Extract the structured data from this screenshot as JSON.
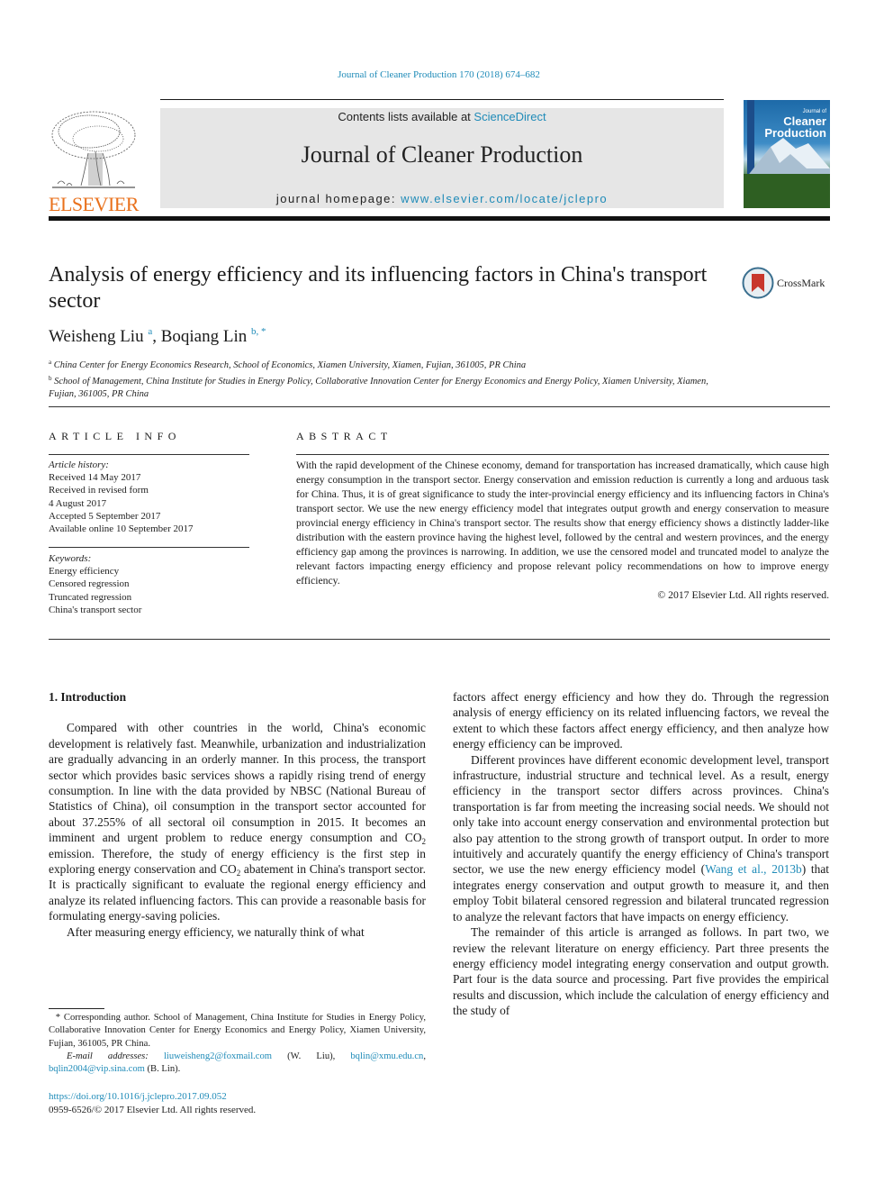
{
  "header": {
    "citation": "Journal of Cleaner Production 170 (2018) 674–682",
    "contents_prefix": "Contents lists available at ",
    "contents_link": "ScienceDirect",
    "journal_title": "Journal of Cleaner Production",
    "homepage_prefix": "journal homepage: ",
    "homepage_link": "www.elsevier.com/locate/jclepro",
    "publisher_wordmark": "ELSEVIER",
    "cover_small": "Journal of",
    "cover_line1": "Cleaner",
    "cover_line2": "Production",
    "brand_colors": {
      "elsevier_orange": "#e9711c",
      "link_blue": "#1f8bb8"
    }
  },
  "article": {
    "title": "Analysis of energy efficiency and its influencing factors in China's transport sector",
    "crossmark_label": "CrossMark",
    "authors": [
      {
        "name": "Weisheng Liu",
        "marks": "a"
      },
      {
        "name": "Boqiang Lin",
        "marks": "b, *"
      }
    ],
    "affiliations": [
      {
        "mark": "a",
        "text": "China Center for Energy Economics Research, School of Economics, Xiamen University, Xiamen, Fujian, 361005, PR China"
      },
      {
        "mark": "b",
        "text": "School of Management, China Institute for Studies in Energy Policy, Collaborative Innovation Center for Energy Economics and Energy Policy, Xiamen University, Xiamen, Fujian, 361005, PR China"
      }
    ]
  },
  "article_info": {
    "heading": "ARTICLE INFO",
    "history_label": "Article history:",
    "history": [
      "Received 14 May 2017",
      "Received in revised form",
      "4 August 2017",
      "Accepted 5 September 2017",
      "Available online 10 September 2017"
    ],
    "keywords_label": "Keywords:",
    "keywords": [
      "Energy efficiency",
      "Censored regression",
      "Truncated regression",
      "China's transport sector"
    ]
  },
  "abstract": {
    "heading": "ABSTRACT",
    "text": "With the rapid development of the Chinese economy, demand for transportation has increased dramatically, which cause high energy consumption in the transport sector. Energy conservation and emission reduction is currently a long and arduous task for China. Thus, it is of great significance to study the inter-provincial energy efficiency and its influencing factors in China's transport sector. We use the new energy efficiency model that integrates output growth and energy conservation to measure provincial energy efficiency in China's transport sector. The results show that energy efficiency shows a distinctly ladder-like distribution with the eastern province having the highest level, followed by the central and western provinces, and the energy efficiency gap among the provinces is narrowing. In addition, we use the censored model and truncated model to analyze the relevant factors impacting energy efficiency and propose relevant policy recommendations on how to improve energy efficiency.",
    "copyright": "© 2017 Elsevier Ltd. All rights reserved."
  },
  "body": {
    "section_heading": "1.  Introduction",
    "left_paragraphs": {
      "p1_a": "Compared with other countries in the world, China's economic development is relatively fast. Meanwhile, urbanization and industrialization are gradually advancing in an orderly manner. In this process, the transport sector which provides basic services shows a rapidly rising trend of energy consumption. In line with the data provided by NBSC (National Bureau of Statistics of China), oil consumption in the transport sector accounted for about 37.255% of all sectoral oil consumption in 2015. It becomes an imminent and urgent problem to reduce energy consumption and CO",
      "p1_b": " emission. Therefore, the study of energy efficiency is the first step in exploring energy conservation and CO",
      "p1_c": " abatement in China's transport sector. It is practically significant to evaluate the regional energy efficiency and analyze its related influencing factors. This can provide a reasonable basis for formulating energy-saving policies.",
      "co2_sub": "2",
      "p2": "After measuring energy efficiency, we naturally think of what"
    },
    "right_paragraphs": {
      "p1": "factors affect energy efficiency and how they do. Through the regression analysis of energy efficiency on its related influencing factors, we reveal the extent to which these factors affect energy efficiency, and then analyze how energy efficiency can be improved.",
      "p2_a": "Different provinces have different economic development level, transport infrastructure, industrial structure and technical level. As a result, energy efficiency in the transport sector differs across provinces. China's transportation is far from meeting the increasing social needs. We should not only take into account energy conservation and environmental protection but also pay attention to the strong growth of transport output. In order to more intuitively and accurately quantify the energy efficiency of China's transport sector, we use the new energy efficiency model (",
      "p2_ref": "Wang et al., 2013b",
      "p2_b": ") that integrates energy conservation and output growth to measure it, and then employ Tobit bilateral censored regression and bilateral truncated regression to analyze the relevant factors that have impacts on energy efficiency.",
      "p3": "The remainder of this article is arranged as follows. In part two, we review the relevant literature on energy efficiency. Part three presents the energy efficiency model integrating energy conservation and output growth. Part four is the data source and processing. Part five provides the empirical results and discussion, which include the calculation of energy efficiency and the study of"
    }
  },
  "footnote": {
    "star": "*",
    "corresponding": " Corresponding author. School of Management, China Institute for Studies in Energy Policy, Collaborative Innovation Center for Energy Economics and Energy Policy, Xiamen University, Fujian, 361005, PR China.",
    "email_label": "E-mail addresses:",
    "email1": "liuweisheng2@foxmail.com",
    "email1_owner": " (W. Liu), ",
    "email2": "bqlin@xmu.edu.cn",
    "email_sep": ", ",
    "email3": "bqlin2004@vip.sina.com",
    "email3_owner": " (B. Lin)."
  },
  "footer": {
    "doi": "https://doi.org/10.1016/j.jclepro.2017.09.052",
    "issn_copyright": "0959-6526/© 2017 Elsevier Ltd. All rights reserved."
  }
}
